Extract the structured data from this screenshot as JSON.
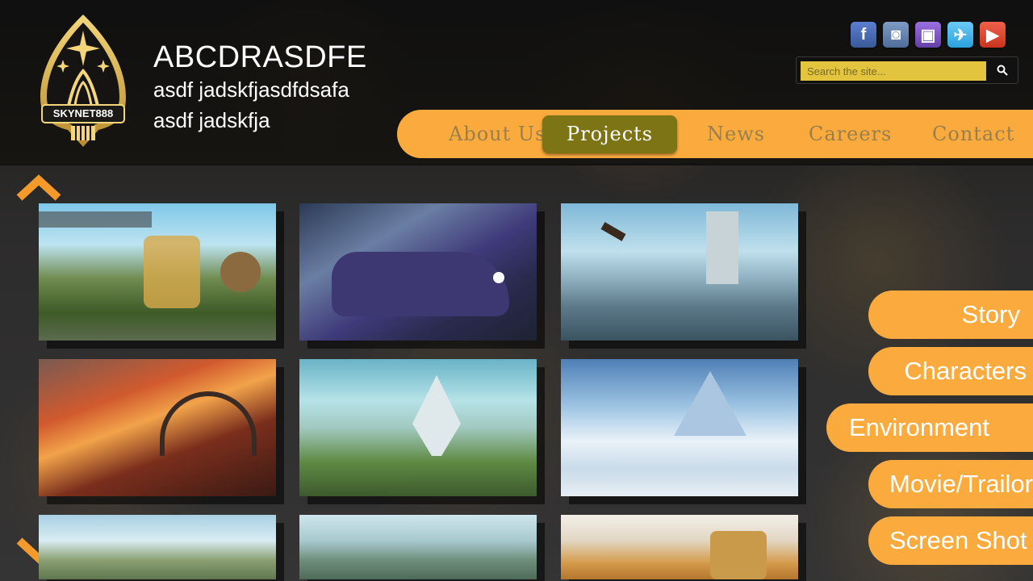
{
  "header": {
    "logo_text": "SKYNET888",
    "title": "ABCDRASDFE",
    "subtitle_line1": "asdf jadskfjasdfdsafa",
    "subtitle_line2": "asdf jadskfja"
  },
  "social": [
    {
      "name": "facebook",
      "glyph": "f"
    },
    {
      "name": "instagram",
      "glyph": "◙"
    },
    {
      "name": "twitch",
      "glyph": "▣"
    },
    {
      "name": "twitter",
      "glyph": "✈"
    },
    {
      "name": "youtube",
      "glyph": "▶"
    }
  ],
  "search": {
    "placeholder": "Search the site..."
  },
  "nav": {
    "items": [
      "About Us",
      "Projects",
      "News",
      "Careers",
      "Contact"
    ],
    "active": "Projects"
  },
  "side_menu": {
    "items": [
      "Story",
      "Characters",
      "Environment",
      "Movie/Trailor",
      "Screen Shot"
    ],
    "active": "Environment"
  },
  "colors": {
    "accent": "#fbab3d",
    "nav_active": "#7d7515",
    "search_field": "#e2c43f"
  }
}
